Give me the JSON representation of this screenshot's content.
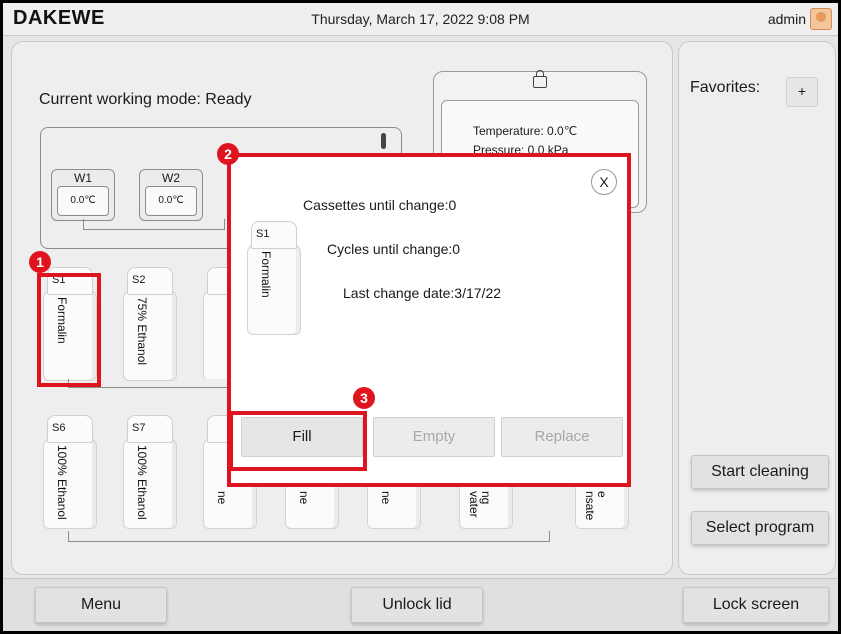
{
  "header": {
    "brand": "DAKEWE",
    "datetime": "Thursday, March 17, 2022 9:08 PM",
    "user": "admin"
  },
  "main": {
    "working_mode": "Current working mode: Ready",
    "lid": {
      "temperature": "Temperature: 0.0℃",
      "pressure": "Pressure: 0.0 kPa"
    },
    "waxbaths": [
      {
        "label": "W1",
        "temp": "0.0℃"
      },
      {
        "label": "W2",
        "temp": "0.0℃"
      }
    ],
    "reagents_row1": [
      {
        "id": "S1",
        "name": "Formalin"
      },
      {
        "id": "S2",
        "name": "75% Ethanol"
      }
    ],
    "reagents_row2": [
      {
        "id": "S6",
        "name": "100% Ethanol"
      },
      {
        "id": "S7",
        "name": "100% Ethanol"
      }
    ],
    "hidden_fragments": [
      "ne",
      "ne",
      "ne",
      "vater",
      "ng",
      "nsate",
      "e"
    ]
  },
  "modal": {
    "close": "X",
    "bottle_id": "S1",
    "bottle_name": "Formalin",
    "cassettes": "Cassettes until change:0",
    "cycles": "Cycles until change:0",
    "last_change": "Last change date:3/17/22",
    "buttons": {
      "fill": "Fill",
      "empty": "Empty",
      "replace": "Replace"
    }
  },
  "annotations": [
    "1",
    "2",
    "3"
  ],
  "sidebar": {
    "favorites_label": "Favorites:",
    "add": "+",
    "start_cleaning": "Start cleaning",
    "select_program": "Select program"
  },
  "bottom": {
    "menu": "Menu",
    "unlock_lid": "Unlock lid",
    "lock_screen": "Lock screen"
  },
  "colors": {
    "highlight": "#e0141e",
    "panel": "#eeeeee",
    "background": "#e6e6e6"
  }
}
